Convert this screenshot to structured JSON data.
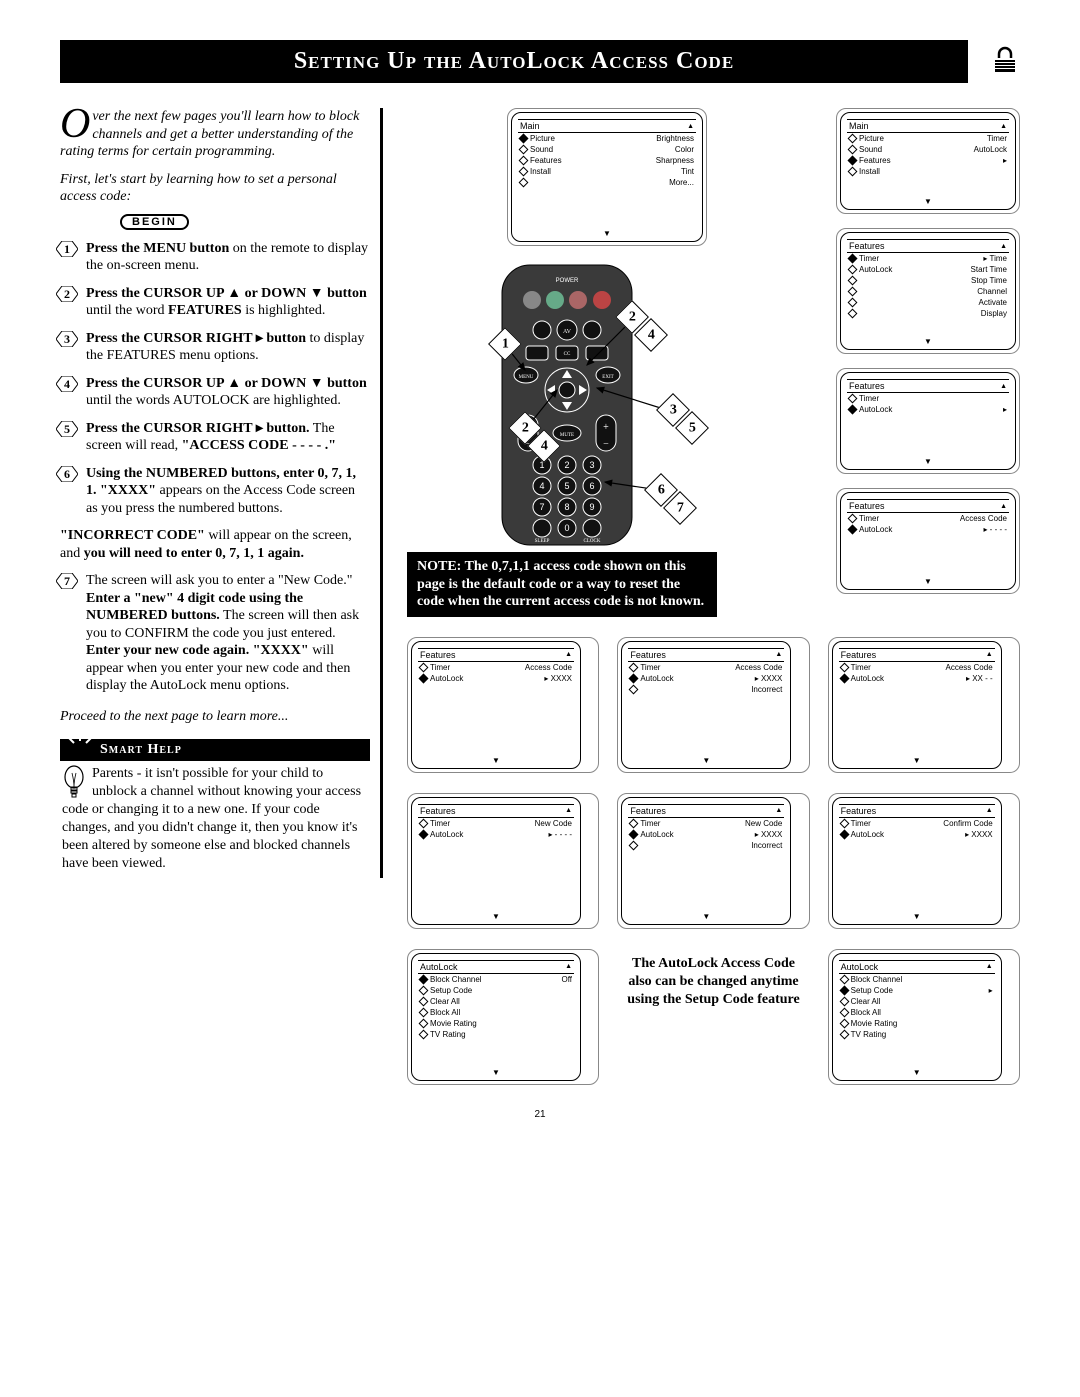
{
  "page_number": "21",
  "banner_title": "Setting Up the AutoLock Access Code",
  "intro_text": "ver the next few pages you'll learn how to block channels and get a better understanding of the rating terms for certain programming.",
  "intro_drop": "O",
  "first_line": "First, let's start by learning how to set a personal access code:",
  "begin_label": "BEGIN",
  "steps": [
    {
      "n": "1",
      "html": "<b>Press the MENU button</b> on the remote to display the on-screen menu."
    },
    {
      "n": "2",
      "html": "<b>Press the CURSOR UP ▲ or DOWN ▼ button</b> until the word <b>FEATURES</b> is highlighted."
    },
    {
      "n": "3",
      "html": "<b>Press the CURSOR RIGHT ▸ button</b> to display the FEATURES menu options."
    },
    {
      "n": "4",
      "html": "<b>Press the CURSOR UP ▲ or DOWN ▼ button</b> until the words AUTOLOCK are highlighted."
    },
    {
      "n": "5",
      "html": "<b>Press the CURSOR RIGHT ▸ button.</b> The screen will read, <b>\"ACCESS CODE - - - - .\"</b>"
    },
    {
      "n": "6",
      "html": "<b>Using the NUMBERED buttons, enter 0, 7, 1, 1. \"XXXX\"</b> appears on the Access Code screen as you press the numbered buttons."
    }
  ],
  "incorrect_text": "<b>\"INCORRECT CODE\"</b> will appear on the screen, and <b>you will need to enter 0, 7, 1, 1 again.</b>",
  "step7": {
    "n": "7",
    "html": "The screen will ask you to enter a \"New Code.\" <b>Enter a \"new\" 4 digit code using the NUMBERED buttons.</b> The screen will then ask you to CONFIRM the code you just entered. <b>Enter your new code again. \"XXXX\"</b> will appear when you enter your new code and then display the AutoLock menu options."
  },
  "proceed_text": "Proceed to the next page to learn more...",
  "smarthelp_title": "Smart Help",
  "smarthelp_body": "Parents - it isn't possible for your child to unblock a channel without knowing your access code or changing it to a new one. If your code changes, and you didn't change it, then you know it's been altered by someone else and blocked channels have been viewed.",
  "note_box": "NOTE: The 0,7,1,1 access code shown on this page is the default code or a way to reset the code when the current access code is not known.",
  "autolock_side_note": "The AutoLock Access Code also can be changed anytime using the Setup Code feature",
  "screens": {
    "main1": {
      "title": "Main",
      "rows": [
        {
          "l": "Picture",
          "r": "Brightness",
          "sel": true
        },
        {
          "l": "Sound",
          "r": "Color"
        },
        {
          "l": "Features",
          "r": "Sharpness"
        },
        {
          "l": "Install",
          "r": "Tint"
        },
        {
          "l": "",
          "r": "More..."
        }
      ]
    },
    "main2": {
      "title": "Main",
      "rows": [
        {
          "l": "Picture",
          "r": "Timer"
        },
        {
          "l": "Sound",
          "r": "AutoLock"
        },
        {
          "l": "Features",
          "r": "",
          "sel": true,
          "arrow": true
        },
        {
          "l": "Install",
          "r": ""
        }
      ]
    },
    "features1": {
      "title": "Features",
      "rows": [
        {
          "l": "Timer",
          "r": "Time",
          "sel": true,
          "arrow": true
        },
        {
          "l": "AutoLock",
          "r": "Start Time"
        },
        {
          "l": "",
          "r": "Stop Time"
        },
        {
          "l": "",
          "r": "Channel"
        },
        {
          "l": "",
          "r": "Activate"
        },
        {
          "l": "",
          "r": "Display"
        }
      ]
    },
    "features2": {
      "title": "Features",
      "rows": [
        {
          "l": "Timer",
          "r": ""
        },
        {
          "l": "AutoLock",
          "r": "",
          "sel": true,
          "arrow": true
        }
      ]
    },
    "features_access": {
      "title": "Features",
      "rows": [
        {
          "l": "Timer",
          "r": "Access Code"
        },
        {
          "l": "AutoLock",
          "r": "- - - -",
          "sel": true,
          "arrow": true
        }
      ]
    },
    "row2": [
      {
        "title": "Features",
        "rows": [
          {
            "l": "Timer",
            "r": "Access Code"
          },
          {
            "l": "AutoLock",
            "r": "XXXX",
            "sel": true,
            "arrow": true
          }
        ]
      },
      {
        "title": "Features",
        "rows": [
          {
            "l": "Timer",
            "r": "Access Code"
          },
          {
            "l": "AutoLock",
            "r": "XXXX",
            "sel": true,
            "arrow": true
          },
          {
            "l": "",
            "r": "Incorrect"
          }
        ]
      },
      {
        "title": "Features",
        "rows": [
          {
            "l": "Timer",
            "r": "Access Code"
          },
          {
            "l": "AutoLock",
            "r": "XX - -",
            "sel": true,
            "arrow": true
          }
        ]
      }
    ],
    "row3": [
      {
        "title": "Features",
        "rows": [
          {
            "l": "Timer",
            "r": "New Code"
          },
          {
            "l": "AutoLock",
            "r": "- - - -",
            "sel": true,
            "arrow": true
          }
        ]
      },
      {
        "title": "Features",
        "rows": [
          {
            "l": "Timer",
            "r": "New Code"
          },
          {
            "l": "AutoLock",
            "r": "XXXX",
            "sel": true,
            "arrow": true
          },
          {
            "l": "",
            "r": "Incorrect"
          }
        ]
      },
      {
        "title": "Features",
        "rows": [
          {
            "l": "Timer",
            "r": "Confirm Code"
          },
          {
            "l": "AutoLock",
            "r": "XXXX",
            "sel": true,
            "arrow": true
          }
        ]
      }
    ],
    "autolock_menus": [
      {
        "title": "AutoLock",
        "rows": [
          {
            "l": "Block Channel",
            "r": "Off",
            "sel": true
          },
          {
            "l": "Setup Code",
            "r": ""
          },
          {
            "l": "Clear All",
            "r": ""
          },
          {
            "l": "Block All",
            "r": ""
          },
          {
            "l": "Movie Rating",
            "r": ""
          },
          {
            "l": "TV Rating",
            "r": ""
          }
        ]
      },
      {
        "title": "AutoLock",
        "rows": [
          {
            "l": "Block Channel",
            "r": ""
          },
          {
            "l": "Setup Code",
            "r": "",
            "sel": true,
            "arrow": true
          },
          {
            "l": "Clear All",
            "r": ""
          },
          {
            "l": "Block All",
            "r": ""
          },
          {
            "l": "Movie Rating",
            "r": ""
          },
          {
            "l": "TV Rating",
            "r": ""
          }
        ]
      }
    ]
  },
  "remote_callouts": [
    "1",
    "2",
    "4",
    "2",
    "4",
    "3",
    "5",
    "6",
    "7"
  ]
}
